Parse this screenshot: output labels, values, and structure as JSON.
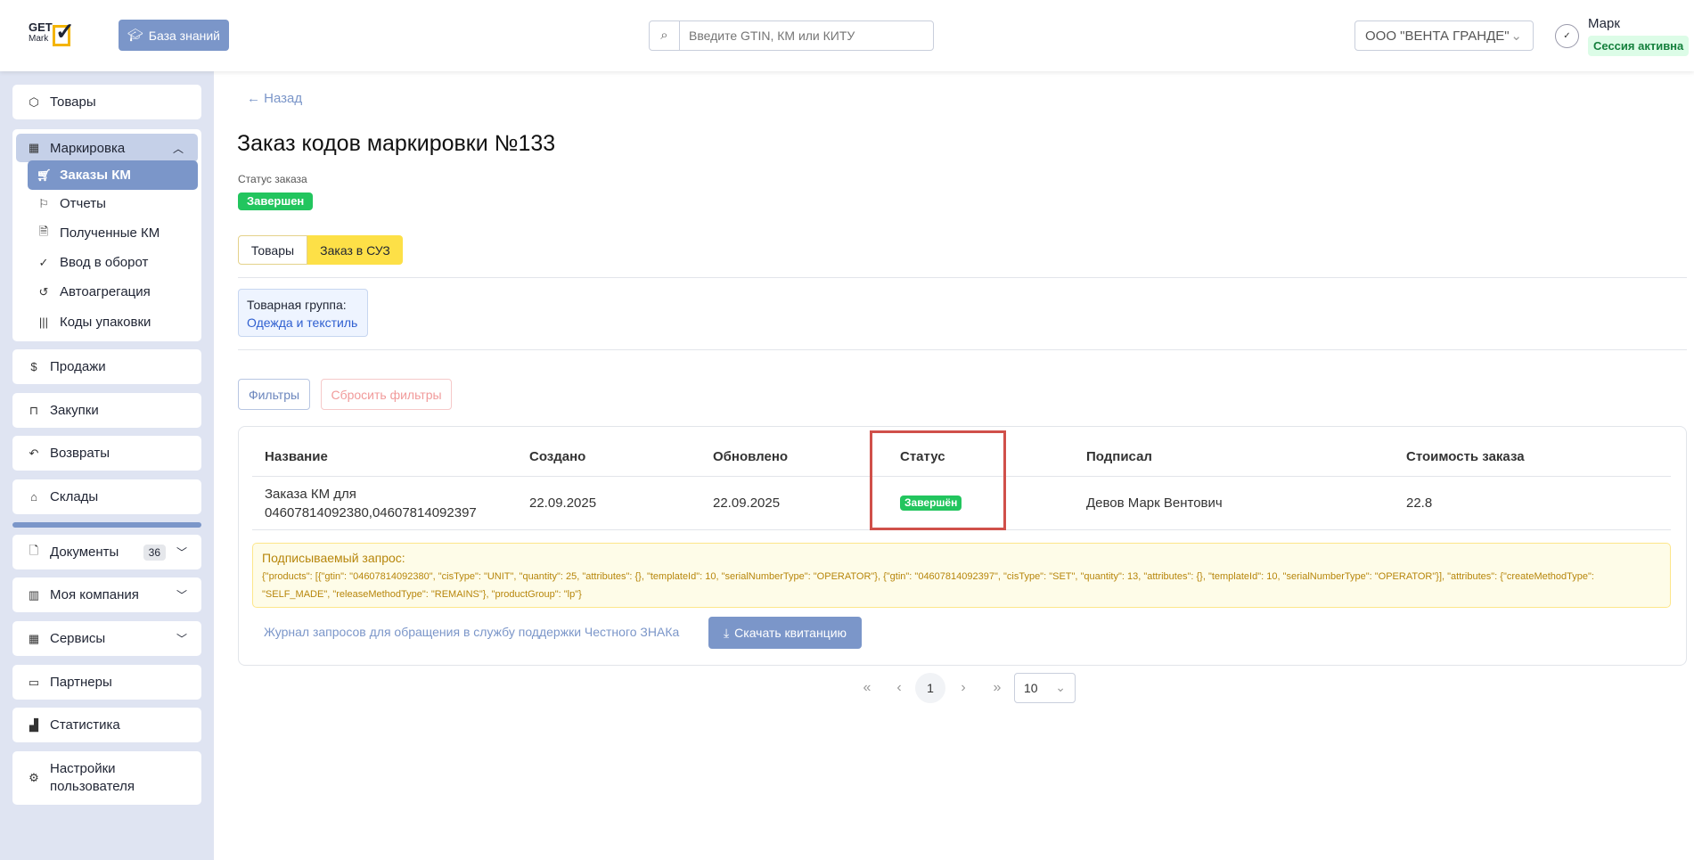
{
  "header": {
    "logo_text": "GET Mark",
    "knowledge_base": "База знаний",
    "search_placeholder": "Введите GTIN, КМ или КИТУ",
    "organization": "ООО \"ВЕНТА ГРАНДЕ\"",
    "user_name": "Марк",
    "session_status": "Сессия активна"
  },
  "sidebar": {
    "goods": "Товары",
    "marking": "Маркировка",
    "marking_items": [
      "Заказы КМ",
      "Отчеты",
      "Полученные КМ",
      "Ввод в оборот",
      "Автоагрегация",
      "Коды упаковки"
    ],
    "sales": "Продажи",
    "purchases": "Закупки",
    "returns": "Возвраты",
    "warehouses": "Склады",
    "documents": "Документы",
    "documents_count": "36",
    "company": "Моя компания",
    "services": "Сервисы",
    "partners": "Партнеры",
    "statistics": "Статистика",
    "settings": "Настройки пользователя"
  },
  "main": {
    "back": "← Назад",
    "title": "Заказ кодов маркировки №133",
    "status_label": "Статус заказа",
    "status": "Завершен",
    "tabs": [
      "Товары",
      "Заказ в СУЗ"
    ],
    "group_label": "Товарная группа:",
    "group_value": "Одежда и текстиль",
    "filters": "Фильтры",
    "reset_filters": "Сбросить фильтры",
    "table": {
      "headers": [
        "Название",
        "Создано",
        "Обновлено",
        "Статус",
        "Подписал",
        "Стоимость заказа"
      ],
      "rows": [
        {
          "name_line1": "Заказа КМ для",
          "name_line2": "04607814092380,04607814092397",
          "created": "22.09.2025",
          "updated": "22.09.2025",
          "status": "Завершён",
          "signed_by": "Девов Марк Вентович",
          "cost": "22.8"
        }
      ]
    },
    "request_label": "Подписываемый запрос:",
    "request_body": "{\"products\": [{\"gtin\": \"04607814092380\", \"cisType\": \"UNIT\", \"quantity\": 25, \"attributes\": {}, \"templateId\": 10, \"serialNumberType\": \"OPERATOR\"}, {\"gtin\": \"04607814092397\", \"cisType\": \"SET\", \"quantity\": 13, \"attributes\": {}, \"templateId\": 10, \"serialNumberType\": \"OPERATOR\"}], \"attributes\": {\"createMethodType\": \"SELF_MADE\", \"releaseMethodType\": \"REMAINS\"}, \"productGroup\": \"lp\"}",
    "journal_link": "Журнал запросов для обращения в службу поддержки Честного ЗНАКа",
    "download": "Скачать квитанцию"
  },
  "pagination": {
    "first": "«",
    "prev": "‹",
    "current": "1",
    "next": "›",
    "last": "»",
    "page_size": "10"
  },
  "colors": {
    "accent": "#7b96c9",
    "success": "#22c55e",
    "tab_active": "#fde047",
    "highlight": "#d0504a"
  }
}
